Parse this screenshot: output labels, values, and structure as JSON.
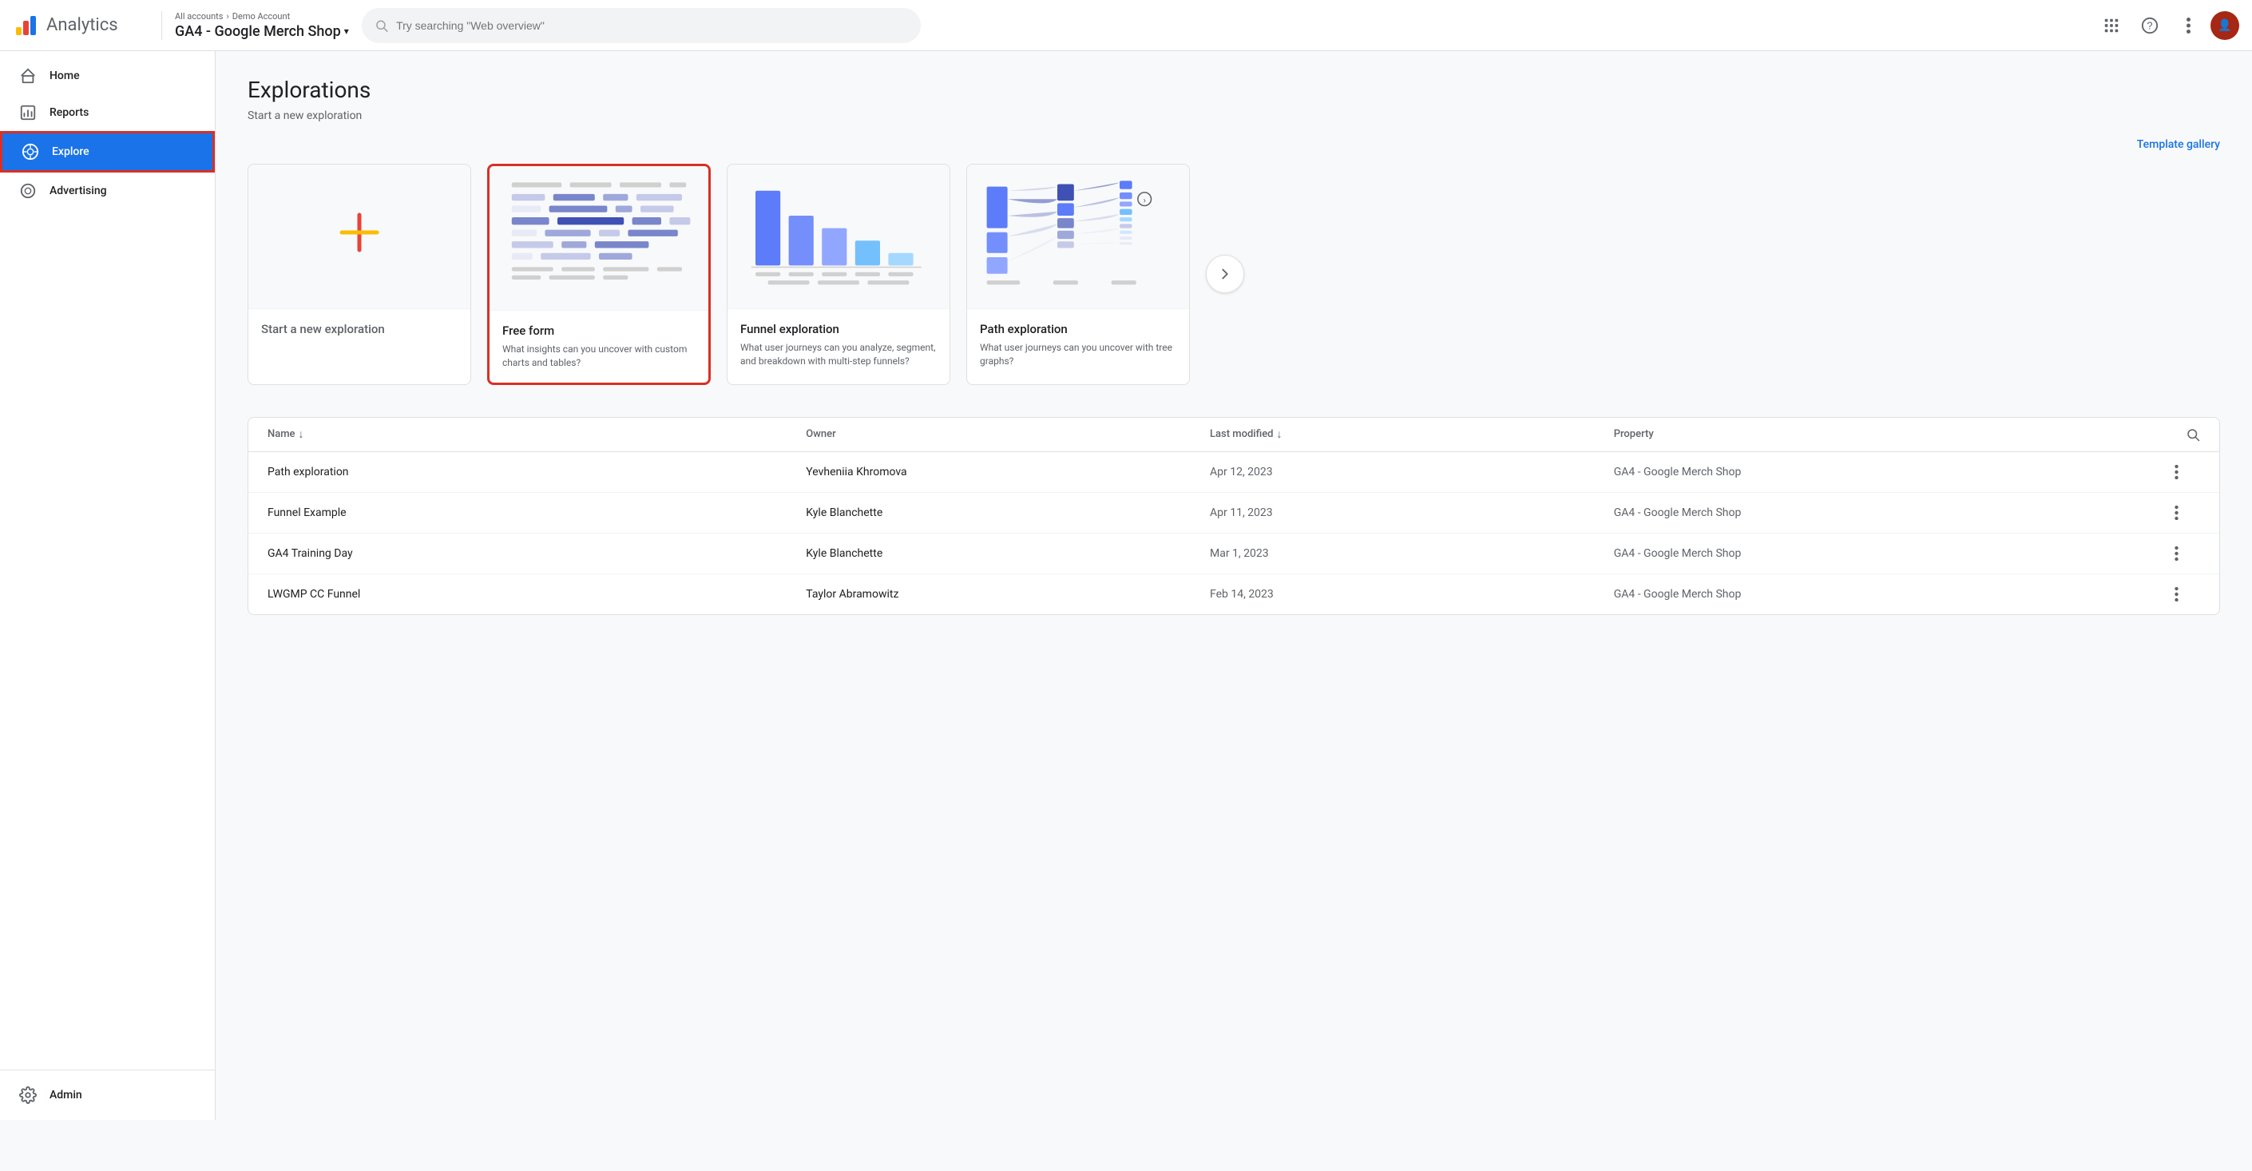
{
  "topbar": {
    "logo_text": "Analytics",
    "breadcrumb_all": "All accounts",
    "breadcrumb_separator": "›",
    "breadcrumb_account": "Demo Account",
    "property_name": "GA4 - Google Merch Shop",
    "property_dropdown": "▾",
    "search_placeholder": "Try searching \"Web overview\""
  },
  "sidebar": {
    "items": [
      {
        "id": "home",
        "label": "Home",
        "icon": "home"
      },
      {
        "id": "reports",
        "label": "Reports",
        "icon": "reports"
      },
      {
        "id": "explore",
        "label": "Explore",
        "icon": "explore",
        "active": true
      },
      {
        "id": "advertising",
        "label": "Advertising",
        "icon": "advertising"
      }
    ],
    "bottom_items": [
      {
        "id": "admin",
        "label": "Admin",
        "icon": "settings"
      }
    ]
  },
  "main": {
    "page_title": "Explorations",
    "section_new": "Start a new exploration",
    "template_gallery_label": "Template gallery",
    "cards": [
      {
        "id": "new",
        "title": "Start a new exploration",
        "desc": "",
        "type": "new"
      },
      {
        "id": "freeform",
        "title": "Free form",
        "desc": "What insights can you uncover with custom charts and tables?",
        "type": "freeform",
        "selected": true
      },
      {
        "id": "funnel",
        "title": "Funnel exploration",
        "desc": "What user journeys can you analyze, segment, and breakdown with multi-step funnels?",
        "type": "funnel",
        "selected": false
      },
      {
        "id": "path",
        "title": "Path exploration",
        "desc": "What user journeys can you uncover with tree graphs?",
        "type": "path",
        "selected": false
      }
    ],
    "table": {
      "columns": [
        "Name",
        "Owner",
        "Last modified",
        "Property"
      ],
      "rows": [
        {
          "name": "Path exploration",
          "owner": "Yevheniia Khromova",
          "modified": "Apr 12, 2023",
          "property": "GA4 - Google Merch Shop"
        },
        {
          "name": "Funnel Example",
          "owner": "Kyle Blanchette",
          "modified": "Apr 11, 2023",
          "property": "GA4 - Google Merch Shop"
        },
        {
          "name": "GA4 Training Day",
          "owner": "Kyle Blanchette",
          "modified": "Mar 1, 2023",
          "property": "GA4 - Google Merch Shop"
        },
        {
          "name": "LWGMP CC Funnel",
          "owner": "Taylor Abramowitz",
          "modified": "Feb 14, 2023",
          "property": "GA4 - Google Merch Shop"
        }
      ]
    }
  }
}
